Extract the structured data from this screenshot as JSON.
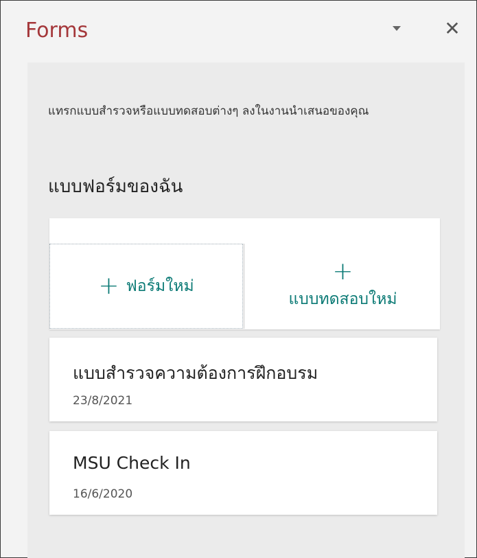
{
  "panel": {
    "title": "Forms",
    "dropdown_icon": "chevron-down-icon",
    "close_label": "✕"
  },
  "content": {
    "intro": "แทรกแบบสำรวจหรือแบบทดสอบต่างๆ ลงในงานนำเสนอของคุณ",
    "section_title": "แบบฟอร์มของฉัน",
    "new_form": {
      "plus": "+",
      "label": "ฟอร์มใหม่"
    },
    "new_quiz": {
      "plus": "+",
      "label": "แบบทดสอบใหม่"
    },
    "forms": [
      {
        "name": "แบบสำรวจความต้องการฝึกอบรม",
        "date": "23/8/2021"
      },
      {
        "name": "MSU Check In",
        "date": "16/6/2020"
      }
    ]
  },
  "colors": {
    "title": "#a4373a",
    "accent": "#0b7a75",
    "panel_bg": "#f3f3f3",
    "content_bg": "#ebebeb"
  }
}
